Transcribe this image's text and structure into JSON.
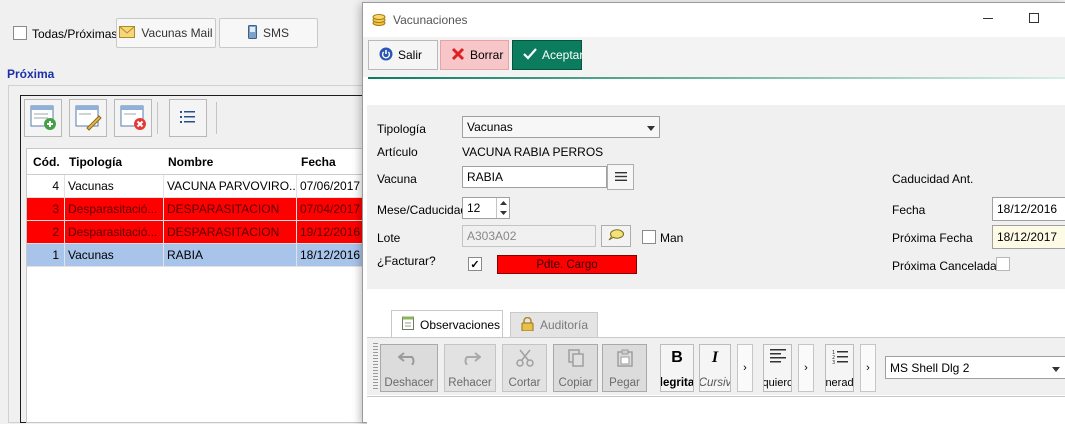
{
  "background": {
    "todas_label": "Todas/Próximas",
    "mail_button": "Vacunas Mail",
    "sms_button": "SMS",
    "section_title": "Próxima",
    "grid": {
      "headers": [
        "Cód.",
        "Tipología",
        "Nombre",
        "Fecha"
      ],
      "rows": [
        {
          "cod": "4",
          "tipologia": "Vacunas",
          "nombre": "VACUNA PARVOVIRO...",
          "fecha": "07/06/2017",
          "style": "normal"
        },
        {
          "cod": "3",
          "tipologia": "Desparasitació...",
          "nombre": "DESPARASITACION",
          "fecha": "07/04/2017",
          "style": "red"
        },
        {
          "cod": "2",
          "tipologia": "Desparasitació...",
          "nombre": "DESPARASITACION",
          "fecha": "19/12/2016",
          "style": "red"
        },
        {
          "cod": "1",
          "tipologia": "Vacunas",
          "nombre": "RABIA",
          "fecha": "18/12/2016",
          "style": "selected"
        }
      ]
    }
  },
  "dialog": {
    "title": "Vacunaciones",
    "buttons": {
      "salir": "Salir",
      "borrar": "Borrar",
      "aceptar": "Aceptar"
    },
    "labels": {
      "tipologia": "Tipología",
      "articulo": "Artículo",
      "vacuna": "Vacuna",
      "meses": "Mese/Caducidad",
      "lote": "Lote",
      "facturar": "¿Facturar?",
      "man": "Man",
      "caducidad_ant": "Caducidad Ant.",
      "fecha": "Fecha",
      "proxima_fecha": "Próxima Fecha",
      "proxima_cancelada": "Próxima Cancelada"
    },
    "values": {
      "tipologia": "Vacunas",
      "articulo": "VACUNA RABIA PERROS",
      "vacuna": "RABIA",
      "meses": "12",
      "lote": "A303A02",
      "facturar_checked": "✓",
      "pdte_cargo": "Pdte. Cargo",
      "fecha": "18/12/2016",
      "proxima_fecha": "18/12/2017"
    },
    "tabs": {
      "observaciones": "Observaciones",
      "auditoria": "Auditoría"
    },
    "rich_toolbar": {
      "deshacer": "Deshacer",
      "rehacer": "Rehacer",
      "cortar": "Cortar",
      "copiar": "Copiar",
      "pegar": "Pegar",
      "negrita": "legrita",
      "cursiva": "Cursiv",
      "izquierda": "quierc",
      "numerada": "nerad",
      "font": "MS Shell Dlg 2",
      "bold_glyph": "B",
      "italic_glyph": "I",
      "more_glyph": "›"
    }
  },
  "colors": {
    "accent_green": "#0b7d5e",
    "delete_pink": "#f7c6c9",
    "red_row": "#ff0000",
    "selected_row": "#a9c4ea",
    "link_blue": "#1a2fa8"
  }
}
